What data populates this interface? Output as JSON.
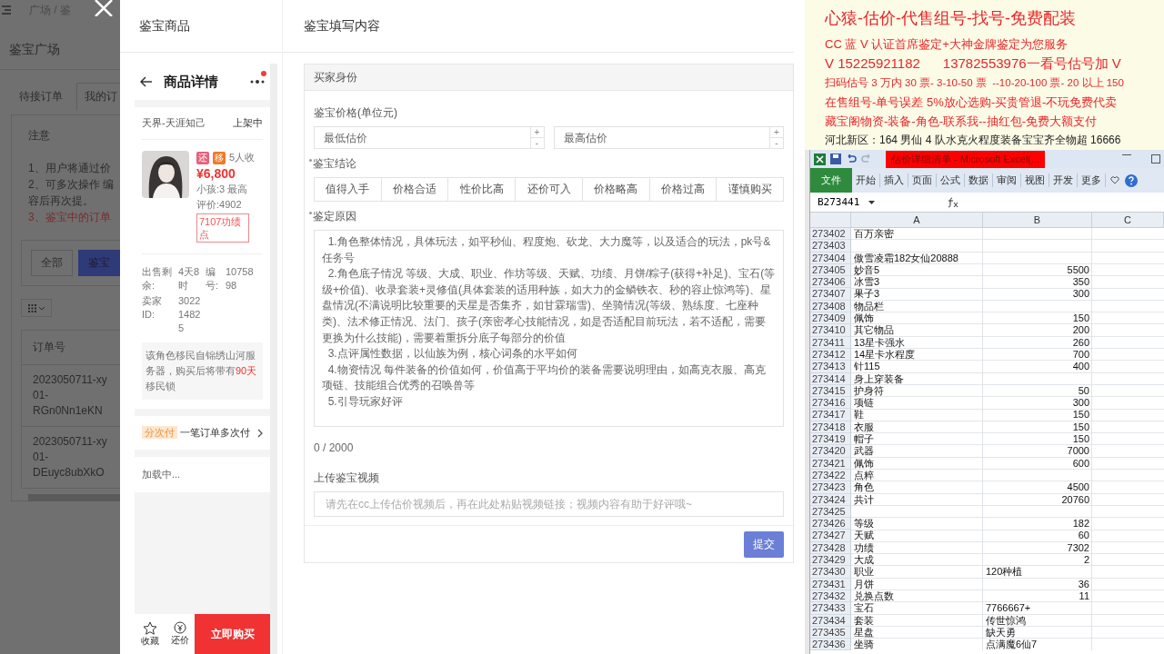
{
  "background_page": {
    "breadcrumb": "广场 / 鉴",
    "title": "鉴宝广场",
    "tabs": [
      {
        "label": "待接订单",
        "selected": false
      },
      {
        "label": "我的订",
        "selected": true
      }
    ],
    "notice_title": "注意",
    "notice_lines": [
      {
        "text": "1、用户将通过价",
        "warning": false
      },
      {
        "text": "2、可多次操作 编",
        "warning": false
      },
      {
        "text": "容后再次提。",
        "warning": false
      },
      {
        "text": "3、鉴宝中的订单",
        "warning": true
      }
    ],
    "filters": [
      {
        "label": "全部",
        "selected": false
      },
      {
        "label": "鉴宝",
        "selected": true
      }
    ],
    "table": {
      "columns": [
        "订单号"
      ],
      "rows": [
        {
          "lines": [
            "2023050711-xy",
            "01-",
            "RGn0Nn1eKN"
          ]
        },
        {
          "lines": [
            "2023050711-xy",
            "01-",
            "DEuyc8ubXkO"
          ]
        }
      ]
    }
  },
  "modal": {
    "left_heading": "鉴宝商品",
    "right_heading": "鉴宝填写内容"
  },
  "phone": {
    "title": "商品详情",
    "notification": true,
    "server": "天界-天涯知己",
    "status": "上架中",
    "tags": [
      {
        "label": "还",
        "color": "#e8607a"
      },
      {
        "label": "移",
        "color": "#f07a28"
      }
    ],
    "favorites": "5人收",
    "price": "¥6,800",
    "attrs": [
      "小孩:3 最高",
      "评价:4902"
    ],
    "merit": "7107功绩点",
    "details": [
      {
        "label": "出售剩余:",
        "value": "4天8时"
      },
      {
        "label": "编号:",
        "value": "1075898"
      },
      {
        "label": "卖家ID:",
        "value": "302214825"
      }
    ],
    "notice": [
      {
        "text": "该角色移民自锦绣山河服务器，购买后将带有",
        "highlight": false
      },
      {
        "text": "90天",
        "highlight": true
      },
      {
        "text": "移民锁",
        "highlight": false
      }
    ],
    "installment": {
      "tag": "分次付",
      "text": "一笔订单多次付"
    },
    "loading": "加载中...",
    "actions": [
      {
        "kind": "star",
        "label": "收藏"
      },
      {
        "kind": "yen",
        "label": "还价"
      }
    ],
    "buy": "立即购买"
  },
  "form": {
    "section": "买家身份",
    "price_label": "鉴宝价格(单位元)",
    "price_fields": [
      {
        "placeholder": "最低估价",
        "up": "+",
        "down": "-"
      },
      {
        "placeholder": "最高估价",
        "up": "+",
        "down": "-"
      }
    ],
    "conclusion": {
      "label": "鉴宝结论",
      "required": true,
      "options": [
        {
          "label": "值得入手",
          "selected": false
        },
        {
          "label": "价格合适",
          "selected": false
        },
        {
          "label": "性价比高",
          "selected": false
        },
        {
          "label": "还价可入",
          "selected": false
        },
        {
          "label": "价格略高",
          "selected": false
        },
        {
          "label": "价格过高",
          "selected": false
        },
        {
          "label": "谨慎购买",
          "selected": false
        }
      ]
    },
    "reason": {
      "label": "鉴定原因",
      "required": true,
      "placeholder": "  1.角色整体情况，具体玩法，如平秒仙、程度炮、砍龙、大力魔等，以及适合的玩法，pk号&任务号\n  2.角色底子情况 等级、大成、职业、作坊等级、天赋、功绩、月饼/粽子(获得+补足)、宝石(等级+价值)、收录套装+灵修值(具体套装的适用种族，如大力的金鳞铁衣、秒的容止惊鸿等)、星盘情况(不满说明比较重要的天星是否集齐，如甘霖瑞雪)、坐骑情况(等级、熟练度、七座种类)、法术修正情况、法门、孩子(亲密孝心技能情况，如是否适配目前玩法，若不适配，需要更换为什么技能)，需要着重拆分底子每部分的价值\n  3.点评属性数据，以仙族为例，核心词条的水平如何\n  4.物资情况 每件装备的价值如何，价值高于平均价的装备需要说明理由，如高克衣服、高克项链、技能组合优秀的召唤兽等\n  5.引导玩家好评"
    },
    "counter": "0 / 2000",
    "video": {
      "label": "上传鉴宝视频",
      "placeholder": "请先在cc上传估价视频后，再在此处粘贴视频链接；视频内容有助于好评哦~"
    },
    "submit": "提交"
  },
  "document": {
    "lines": [
      {
        "kind": "heading",
        "text": "心猿-估价-代售组号-找号-免费配装"
      },
      {
        "kind": "body",
        "text": "CC 蓝 V 认证首席鉴定+大神金牌鉴定为您服务"
      },
      {
        "kind": "emphasis",
        "text": "V 15225921182      13782553976一看号估号加 V"
      },
      {
        "kind": "small",
        "text": "扫码估号 3 万内 30 票- 3-10-50 票  --10-20-100 票- 20 以上 150"
      },
      {
        "kind": "body",
        "text": "在售组号-单号误差 5%放心选购-买贵管退-不玩免费代卖"
      },
      {
        "kind": "body",
        "text": "藏宝阁物资-装备-角色-联系我--抽红包-免费大额支付"
      },
      {
        "kind": "note",
        "text": "河北新区：164 男仙 4 队水克火程度装备宝宝齐全物超 16666"
      }
    ]
  },
  "excel": {
    "title": "估价详细清单 - Microsoft Excel(...",
    "file_tab": "文件",
    "tabs": [
      "开始",
      "插入",
      "页面",
      "公式",
      "数据",
      "审阅",
      "视图",
      "开发",
      "更多"
    ],
    "name_box": "B273441",
    "columns": [
      "A",
      "B",
      "C"
    ],
    "rows": [
      {
        "num": "273402",
        "a": "百万亲密"
      },
      {
        "num": "273403"
      },
      {
        "num": "273404",
        "a": "傲雪凌霜182女仙20888"
      },
      {
        "num": "273405",
        "a": "妙音5",
        "b_number": "5500"
      },
      {
        "num": "273406",
        "a": "冰雪3",
        "b_number": "350"
      },
      {
        "num": "273407",
        "a": "果子3",
        "b_number": "300"
      },
      {
        "num": "273408",
        "a": "物品栏"
      },
      {
        "num": "273409",
        "a": "佩饰",
        "b_number": "150"
      },
      {
        "num": "273410",
        "a": "其它物品",
        "b_number": "200"
      },
      {
        "num": "273411",
        "a": "13星卡强水",
        "b_number": "260"
      },
      {
        "num": "273412",
        "a": "14星卡水程度",
        "b_number": "700"
      },
      {
        "num": "273413",
        "a": "针115",
        "b_number": "400"
      },
      {
        "num": "273414",
        "a": "身上穿装备"
      },
      {
        "num": "273415",
        "a": "护身符",
        "b_number": "50"
      },
      {
        "num": "273416",
        "a": "项链",
        "b_number": "300"
      },
      {
        "num": "273417",
        "a": "鞋",
        "b_number": "150"
      },
      {
        "num": "273418",
        "a": "衣服",
        "b_number": "150"
      },
      {
        "num": "273419",
        "a": "帽子",
        "b_number": "150"
      },
      {
        "num": "273420",
        "a": "武器",
        "b_number": "7000"
      },
      {
        "num": "273421",
        "a": "佩饰",
        "b_number": "600"
      },
      {
        "num": "273422",
        "a": "点粹"
      },
      {
        "num": "273423",
        "a": "角色",
        "b_number": "4500"
      },
      {
        "num": "273424",
        "a": "共计",
        "b_number": "20760"
      },
      {
        "num": "273425"
      },
      {
        "num": "273426",
        "a": "等级",
        "b_number": "182"
      },
      {
        "num": "273427",
        "a": "天赋",
        "b_number": "60"
      },
      {
        "num": "273428",
        "a": "功绩",
        "b_number": "7302"
      },
      {
        "num": "273429",
        "a": "大成",
        "b_number": "2"
      },
      {
        "num": "273430",
        "a": "职业",
        "b_text": "120种植"
      },
      {
        "num": "273431",
        "a": "月饼",
        "b_number": "36"
      },
      {
        "num": "273432",
        "a": "兑换点数",
        "b_number": "11"
      },
      {
        "num": "273433",
        "a": "宝石",
        "b_text": "7766667+"
      },
      {
        "num": "273434",
        "a": "套装",
        "b_text": "传世惊鸿"
      },
      {
        "num": "273435",
        "a": "星盘",
        "b_text": "缺天勇"
      },
      {
        "num": "273436",
        "a": "坐骑",
        "b_text": "点满魔6仙7"
      }
    ]
  }
}
